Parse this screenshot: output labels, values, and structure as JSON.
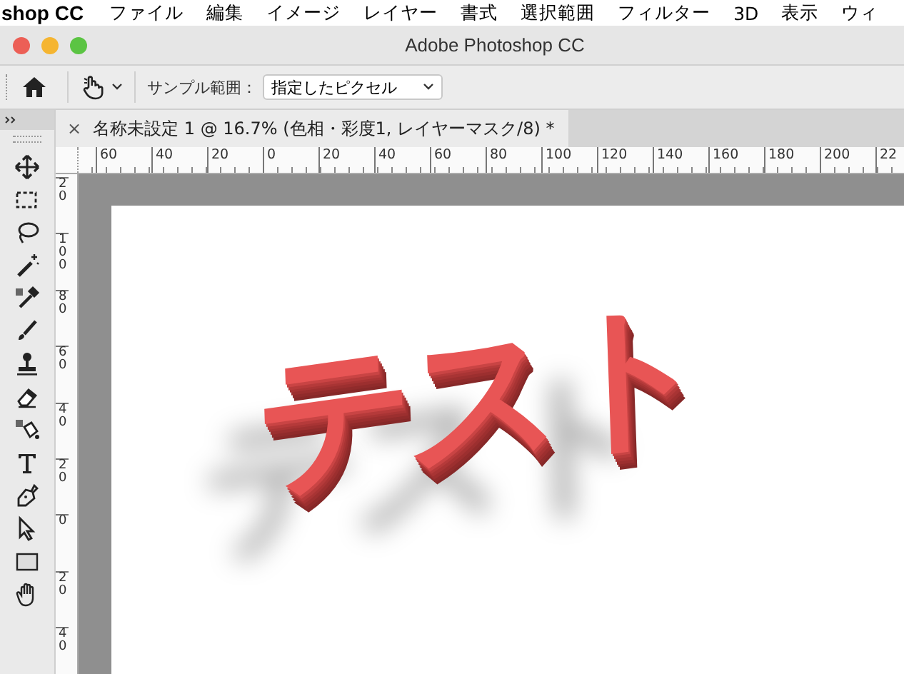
{
  "menu_bar": {
    "app": "shop CC",
    "items": [
      "ファイル",
      "編集",
      "イメージ",
      "レイヤー",
      "書式",
      "選択範囲",
      "フィルター",
      "3D",
      "表示",
      "ウィ"
    ]
  },
  "window": {
    "title": "Adobe Photoshop CC"
  },
  "options_bar": {
    "sample_label": "サンプル範囲：",
    "sample_value": "指定したピクセル"
  },
  "tabs": [
    {
      "close": "×",
      "label": "名称未設定 1 @ 16.7% (色相・彩度1, レイヤーマスク/8) *",
      "selected": true
    }
  ],
  "ruler_h": [
    "60",
    "40",
    "20",
    "0",
    "20",
    "40",
    "60",
    "80",
    "100",
    "120",
    "140",
    "160",
    "180",
    "200",
    "22"
  ],
  "ruler_v": [
    "20",
    "100",
    "80",
    "60",
    "40",
    "20",
    "0",
    "20",
    "40"
  ],
  "canvas": {
    "art_text": "テスト"
  }
}
